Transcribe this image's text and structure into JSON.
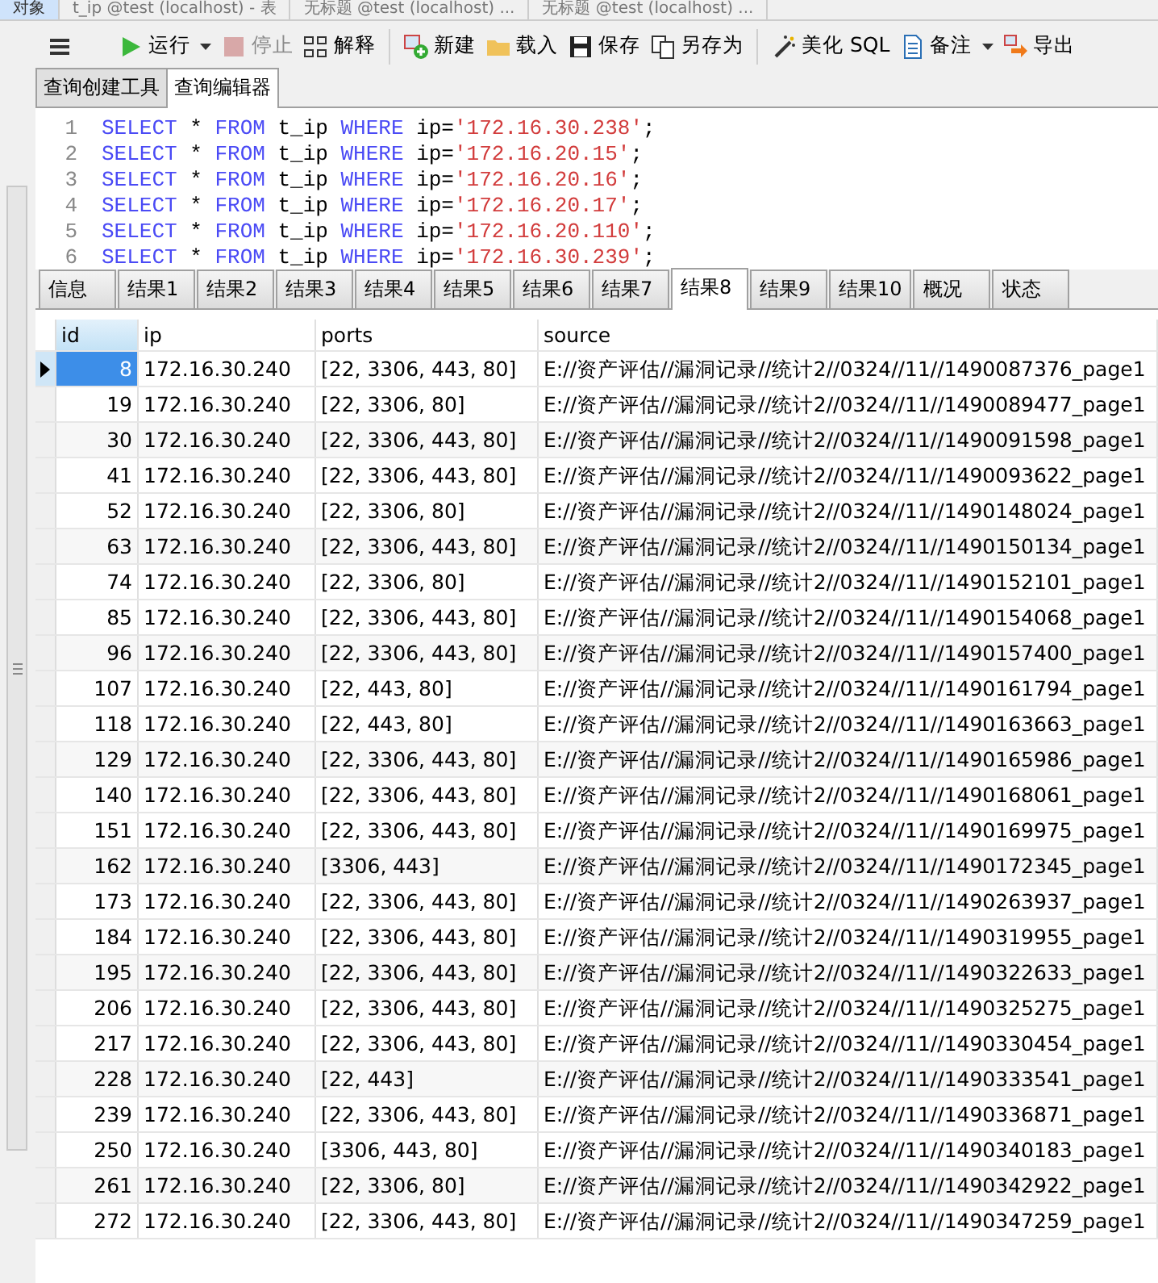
{
  "window_tabs": [
    {
      "label": "对象",
      "selected": true
    },
    {
      "label": "t_ip @test (localhost) - 表",
      "selected": false
    },
    {
      "label": "无标题 @test (localhost) ...",
      "selected": false
    },
    {
      "label": "无标题 @test (localhost) ...",
      "selected": false
    }
  ],
  "toolbar": [
    {
      "kind": "menu"
    },
    {
      "kind": "run",
      "label": "运行",
      "dropdown": true,
      "disabled": false
    },
    {
      "kind": "stop",
      "label": "停止",
      "dropdown": false,
      "disabled": true
    },
    {
      "kind": "explain",
      "label": "解释",
      "dropdown": false,
      "disabled": false
    },
    {
      "kind": "separator"
    },
    {
      "kind": "new",
      "label": "新建",
      "dropdown": false,
      "disabled": false
    },
    {
      "kind": "load",
      "label": "载入",
      "dropdown": false,
      "disabled": false
    },
    {
      "kind": "save",
      "label": "保存",
      "dropdown": false,
      "disabled": false
    },
    {
      "kind": "saveas",
      "label": "另存为",
      "dropdown": false,
      "disabled": false
    },
    {
      "kind": "separator"
    },
    {
      "kind": "beautify",
      "label": "美化 SQL",
      "dropdown": false,
      "disabled": false
    },
    {
      "kind": "note",
      "label": "备注",
      "dropdown": true,
      "disabled": false
    },
    {
      "kind": "export",
      "label": "导出",
      "dropdown": false,
      "disabled": false
    }
  ],
  "editor_tabs": [
    {
      "label": "查询创建工具",
      "selected": false
    },
    {
      "label": "查询编辑器",
      "selected": true
    }
  ],
  "editor_lines": [
    {
      "number": "1",
      "tokens": [
        {
          "kind": "keyword",
          "text": "SELECT"
        },
        {
          "kind": "plain",
          "text": " * "
        },
        {
          "kind": "keyword",
          "text": "FROM"
        },
        {
          "kind": "plain",
          "text": " t_ip "
        },
        {
          "kind": "keyword",
          "text": "WHERE"
        },
        {
          "kind": "plain",
          "text": " ip="
        },
        {
          "kind": "string",
          "text": "'172.16.30.238'"
        },
        {
          "kind": "plain",
          "text": ";"
        }
      ]
    },
    {
      "number": "2",
      "tokens": [
        {
          "kind": "keyword",
          "text": "SELECT"
        },
        {
          "kind": "plain",
          "text": " * "
        },
        {
          "kind": "keyword",
          "text": "FROM"
        },
        {
          "kind": "plain",
          "text": " t_ip "
        },
        {
          "kind": "keyword",
          "text": "WHERE"
        },
        {
          "kind": "plain",
          "text": " ip="
        },
        {
          "kind": "string",
          "text": "'172.16.20.15'"
        },
        {
          "kind": "plain",
          "text": ";"
        }
      ]
    },
    {
      "number": "3",
      "tokens": [
        {
          "kind": "keyword",
          "text": "SELECT"
        },
        {
          "kind": "plain",
          "text": " * "
        },
        {
          "kind": "keyword",
          "text": "FROM"
        },
        {
          "kind": "plain",
          "text": " t_ip "
        },
        {
          "kind": "keyword",
          "text": "WHERE"
        },
        {
          "kind": "plain",
          "text": " ip="
        },
        {
          "kind": "string",
          "text": "'172.16.20.16'"
        },
        {
          "kind": "plain",
          "text": ";"
        }
      ]
    },
    {
      "number": "4",
      "tokens": [
        {
          "kind": "keyword",
          "text": "SELECT"
        },
        {
          "kind": "plain",
          "text": " * "
        },
        {
          "kind": "keyword",
          "text": "FROM"
        },
        {
          "kind": "plain",
          "text": " t_ip "
        },
        {
          "kind": "keyword",
          "text": "WHERE"
        },
        {
          "kind": "plain",
          "text": " ip="
        },
        {
          "kind": "string",
          "text": "'172.16.20.17'"
        },
        {
          "kind": "plain",
          "text": ";"
        }
      ]
    },
    {
      "number": "5",
      "tokens": [
        {
          "kind": "keyword",
          "text": "SELECT"
        },
        {
          "kind": "plain",
          "text": " * "
        },
        {
          "kind": "keyword",
          "text": "FROM"
        },
        {
          "kind": "plain",
          "text": " t_ip "
        },
        {
          "kind": "keyword",
          "text": "WHERE"
        },
        {
          "kind": "plain",
          "text": " ip="
        },
        {
          "kind": "string",
          "text": "'172.16.20.110'"
        },
        {
          "kind": "plain",
          "text": ";"
        }
      ]
    },
    {
      "number": "6",
      "tokens": [
        {
          "kind": "keyword",
          "text": "SELECT"
        },
        {
          "kind": "plain",
          "text": " * "
        },
        {
          "kind": "keyword",
          "text": "FROM"
        },
        {
          "kind": "plain",
          "text": " t_ip "
        },
        {
          "kind": "keyword",
          "text": "WHERE"
        },
        {
          "kind": "plain",
          "text": " ip="
        },
        {
          "kind": "string",
          "text": "'172.16.30.239'"
        },
        {
          "kind": "plain",
          "text": ";"
        }
      ]
    }
  ],
  "result_tabs": [
    {
      "label": "信息",
      "selected": false
    },
    {
      "label": "结果1",
      "selected": false
    },
    {
      "label": "结果2",
      "selected": false
    },
    {
      "label": "结果3",
      "selected": false
    },
    {
      "label": "结果4",
      "selected": false
    },
    {
      "label": "结果5",
      "selected": false
    },
    {
      "label": "结果6",
      "selected": false
    },
    {
      "label": "结果7",
      "selected": false
    },
    {
      "label": "结果8",
      "selected": true
    },
    {
      "label": "结果9",
      "selected": false
    },
    {
      "label": "结果10",
      "selected": false
    },
    {
      "label": "概况",
      "selected": false
    },
    {
      "label": "状态",
      "selected": false
    }
  ],
  "table": {
    "columns": [
      "id",
      "ip",
      "ports",
      "source"
    ],
    "rows": [
      {
        "selected": true,
        "cells": [
          "8",
          "172.16.30.240",
          "[22, 3306, 443, 80]",
          "E://资产评估//漏洞记录//统计2//0324//11//1490087376_page1"
        ]
      },
      {
        "selected": false,
        "cells": [
          "19",
          "172.16.30.240",
          "[22, 3306, 80]",
          "E://资产评估//漏洞记录//统计2//0324//11//1490089477_page1"
        ]
      },
      {
        "selected": false,
        "cells": [
          "30",
          "172.16.30.240",
          "[22, 3306, 443, 80]",
          "E://资产评估//漏洞记录//统计2//0324//11//1490091598_page1"
        ]
      },
      {
        "selected": false,
        "cells": [
          "41",
          "172.16.30.240",
          "[22, 3306, 443, 80]",
          "E://资产评估//漏洞记录//统计2//0324//11//1490093622_page1"
        ]
      },
      {
        "selected": false,
        "cells": [
          "52",
          "172.16.30.240",
          "[22, 3306, 80]",
          "E://资产评估//漏洞记录//统计2//0324//11//1490148024_page1"
        ]
      },
      {
        "selected": false,
        "cells": [
          "63",
          "172.16.30.240",
          "[22, 3306, 443, 80]",
          "E://资产评估//漏洞记录//统计2//0324//11//1490150134_page1"
        ]
      },
      {
        "selected": false,
        "cells": [
          "74",
          "172.16.30.240",
          "[22, 3306, 80]",
          "E://资产评估//漏洞记录//统计2//0324//11//1490152101_page1"
        ]
      },
      {
        "selected": false,
        "cells": [
          "85",
          "172.16.30.240",
          "[22, 3306, 443, 80]",
          "E://资产评估//漏洞记录//统计2//0324//11//1490154068_page1"
        ]
      },
      {
        "selected": false,
        "cells": [
          "96",
          "172.16.30.240",
          "[22, 3306, 443, 80]",
          "E://资产评估//漏洞记录//统计2//0324//11//1490157400_page1"
        ]
      },
      {
        "selected": false,
        "cells": [
          "107",
          "172.16.30.240",
          "[22, 443, 80]",
          "E://资产评估//漏洞记录//统计2//0324//11//1490161794_page1"
        ]
      },
      {
        "selected": false,
        "cells": [
          "118",
          "172.16.30.240",
          "[22, 443, 80]",
          "E://资产评估//漏洞记录//统计2//0324//11//1490163663_page1"
        ]
      },
      {
        "selected": false,
        "cells": [
          "129",
          "172.16.30.240",
          "[22, 3306, 443, 80]",
          "E://资产评估//漏洞记录//统计2//0324//11//1490165986_page1"
        ]
      },
      {
        "selected": false,
        "cells": [
          "140",
          "172.16.30.240",
          "[22, 3306, 443, 80]",
          "E://资产评估//漏洞记录//统计2//0324//11//1490168061_page1"
        ]
      },
      {
        "selected": false,
        "cells": [
          "151",
          "172.16.30.240",
          "[22, 3306, 443, 80]",
          "E://资产评估//漏洞记录//统计2//0324//11//1490169975_page1"
        ]
      },
      {
        "selected": false,
        "cells": [
          "162",
          "172.16.30.240",
          "[3306, 443]",
          "E://资产评估//漏洞记录//统计2//0324//11//1490172345_page1"
        ]
      },
      {
        "selected": false,
        "cells": [
          "173",
          "172.16.30.240",
          "[22, 3306, 443, 80]",
          "E://资产评估//漏洞记录//统计2//0324//11//1490263937_page1"
        ]
      },
      {
        "selected": false,
        "cells": [
          "184",
          "172.16.30.240",
          "[22, 3306, 443, 80]",
          "E://资产评估//漏洞记录//统计2//0324//11//1490319955_page1"
        ]
      },
      {
        "selected": false,
        "cells": [
          "195",
          "172.16.30.240",
          "[22, 3306, 443, 80]",
          "E://资产评估//漏洞记录//统计2//0324//11//1490322633_page1"
        ]
      },
      {
        "selected": false,
        "cells": [
          "206",
          "172.16.30.240",
          "[22, 3306, 443, 80]",
          "E://资产评估//漏洞记录//统计2//0324//11//1490325275_page1"
        ]
      },
      {
        "selected": false,
        "cells": [
          "217",
          "172.16.30.240",
          "[22, 3306, 443, 80]",
          "E://资产评估//漏洞记录//统计2//0324//11//1490330454_page1"
        ]
      },
      {
        "selected": false,
        "cells": [
          "228",
          "172.16.30.240",
          "[22, 443]",
          "E://资产评估//漏洞记录//统计2//0324//11//1490333541_page1"
        ]
      },
      {
        "selected": false,
        "cells": [
          "239",
          "172.16.30.240",
          "[22, 3306, 443, 80]",
          "E://资产评估//漏洞记录//统计2//0324//11//1490336871_page1"
        ]
      },
      {
        "selected": false,
        "cells": [
          "250",
          "172.16.30.240",
          "[3306, 443, 80]",
          "E://资产评估//漏洞记录//统计2//0324//11//1490340183_page1"
        ]
      },
      {
        "selected": false,
        "cells": [
          "261",
          "172.16.30.240",
          "[22, 3306, 80]",
          "E://资产评估//漏洞记录//统计2//0324//11//1490342922_page1"
        ]
      },
      {
        "selected": false,
        "cells": [
          "272",
          "172.16.30.240",
          "[22, 3306, 443, 80]",
          "E://资产评估//漏洞记录//统计2//0324//11//1490347259_page1"
        ]
      }
    ]
  }
}
